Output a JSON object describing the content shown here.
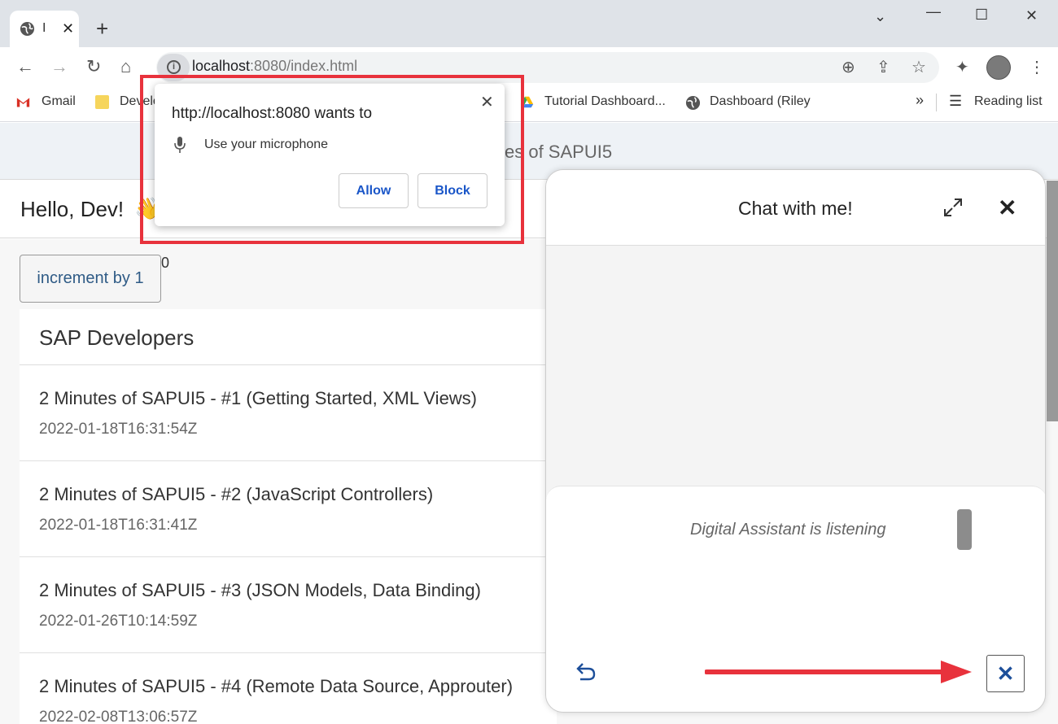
{
  "browser": {
    "tab_title": "I",
    "url_host": "localhost",
    "url_rest": ":8080/index.html",
    "bookmarks": {
      "gmail": "Gmail",
      "devel": "Develo",
      "tutorial": "Tutorial Dashboard...",
      "dashboard": "Dashboard (Riley",
      "more": "»",
      "reading_list": "Reading list"
    }
  },
  "permission_popup": {
    "title": "http://localhost:8080 wants to",
    "permission": "Use your microphone",
    "allow_label": "Allow",
    "block_label": "Block",
    "close_glyph": "✕"
  },
  "page": {
    "header_title": "es of SAPUI5",
    "greeting": "Hello, Dev!",
    "wave_emoji": "👋",
    "increment_button": "increment by 1",
    "counter": "0",
    "list_title": "SAP Developers",
    "items": [
      {
        "title": "2 Minutes of SAPUI5 - #1 (Getting Started, XML Views)",
        "date": "2022-01-18T16:31:54Z"
      },
      {
        "title": "2 Minutes of SAPUI5 - #2 (JavaScript Controllers)",
        "date": "2022-01-18T16:31:41Z"
      },
      {
        "title": "2 Minutes of SAPUI5 - #3 (JSON Models, Data Binding)",
        "date": "2022-01-26T10:14:59Z"
      },
      {
        "title": "2 Minutes of SAPUI5 - #4 (Remote Data Source, Approuter)",
        "date": "2022-02-08T13:06:57Z"
      }
    ]
  },
  "chat": {
    "title": "Chat with me!",
    "status": "Digital Assistant is listening",
    "close_glyph": "✕",
    "stop_glyph": "✕"
  },
  "colors": {
    "annotation_red": "#e8323c",
    "sap_blue": "#1d4f9a",
    "button_link_blue": "#1a56c8"
  }
}
